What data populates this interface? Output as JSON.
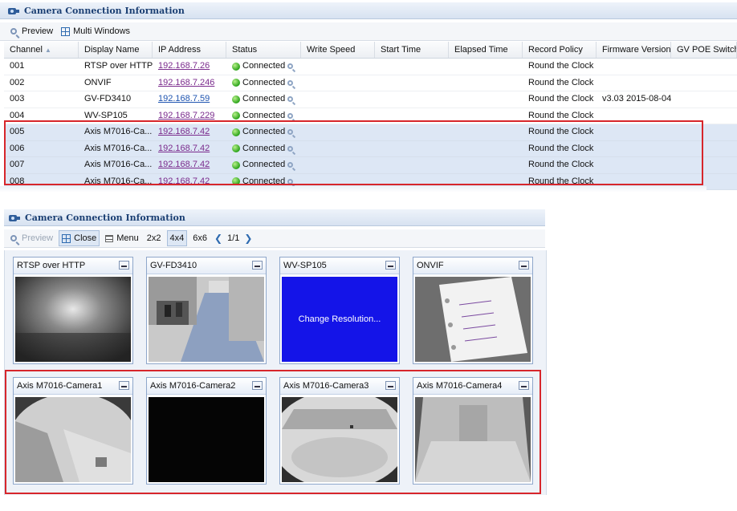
{
  "panel1": {
    "title": "Camera Connection Information",
    "toolbar": {
      "preview": "Preview",
      "multi_windows": "Multi Windows"
    },
    "columns": [
      "Channel",
      "Display Name",
      "IP Address",
      "Status",
      "Write Speed",
      "Start Time",
      "Elapsed Time",
      "Record Policy",
      "Firmware Version",
      "GV POE Switch"
    ],
    "rows": [
      {
        "channel": "001",
        "name": "RTSP over HTTP",
        "ip": "192.168.7.26",
        "status": "Connected",
        "policy": "Round the Clock",
        "firmware": ""
      },
      {
        "channel": "002",
        "name": "ONVIF",
        "ip": "192.168.7.246",
        "status": "Connected",
        "policy": "Round the Clock",
        "firmware": ""
      },
      {
        "channel": "003",
        "name": "GV-FD3410",
        "ip": "192.168.7.59",
        "status": "Connected",
        "policy": "Round the Clock",
        "firmware": "v3.03 2015-08-04"
      },
      {
        "channel": "004",
        "name": "WV-SP105",
        "ip": "192.168.7.229",
        "status": "Connected",
        "policy": "Round the Clock",
        "firmware": ""
      },
      {
        "channel": "005",
        "name": "Axis M7016-Ca...",
        "ip": "192.168.7.42",
        "status": "Connected",
        "policy": "Round the Clock",
        "firmware": ""
      },
      {
        "channel": "006",
        "name": "Axis M7016-Ca...",
        "ip": "192.168.7.42",
        "status": "Connected",
        "policy": "Round the Clock",
        "firmware": ""
      },
      {
        "channel": "007",
        "name": "Axis M7016-Ca...",
        "ip": "192.168.7.42",
        "status": "Connected",
        "policy": "Round the Clock",
        "firmware": ""
      },
      {
        "channel": "008",
        "name": "Axis M7016-Ca...",
        "ip": "192.168.7.42",
        "status": "Connected",
        "policy": "Round the Clock",
        "firmware": ""
      }
    ]
  },
  "panel2": {
    "title": "Camera Connection Information",
    "toolbar": {
      "preview": "Preview",
      "close": "Close",
      "menu": "Menu",
      "layout_2x2": "2x2",
      "layout_4x4": "4x4",
      "layout_6x6": "6x6",
      "page": "1/1"
    },
    "tiles": [
      {
        "title": "RTSP over HTTP",
        "feed": "dark-room"
      },
      {
        "title": "GV-FD3410",
        "feed": "office-hallway"
      },
      {
        "title": "WV-SP105",
        "feed": "blue",
        "message": "Change Resolution..."
      },
      {
        "title": "ONVIF",
        "feed": "binder"
      },
      {
        "title": "Axis M7016-Camera1",
        "feed": "fisheye-corner"
      },
      {
        "title": "Axis M7016-Camera2",
        "feed": "black"
      },
      {
        "title": "Axis M7016-Camera3",
        "feed": "fisheye-room"
      },
      {
        "title": "Axis M7016-Camera4",
        "feed": "fisheye-wall"
      }
    ]
  },
  "colors": {
    "highlight": "#d7262b",
    "selected_row": "#dde7f5",
    "link": "#7a2a8c",
    "header_text": "#1b3f73"
  }
}
